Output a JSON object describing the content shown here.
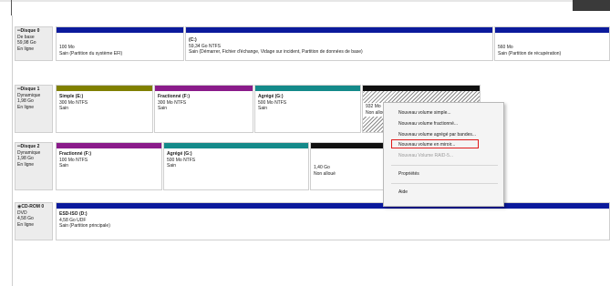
{
  "disks": [
    {
      "name": "Disque 0",
      "type": "De base",
      "size": "59,98 Go",
      "status": "En ligne",
      "partitions": [
        {
          "name": "",
          "size": "100 Mo",
          "fs": "",
          "status": "Sain (Partition du système EFI)"
        },
        {
          "name": "(C:)",
          "size": "59,34 Go NTFS",
          "fs": "",
          "status": "Sain (Démarrer, Fichier d'échange, Vidage sur incident, Partition de données de base)"
        },
        {
          "name": "",
          "size": "560 Mo",
          "fs": "",
          "status": "Sain (Partition de récupération)"
        }
      ]
    },
    {
      "name": "Disque 1",
      "type": "Dynamique",
      "size": "1,98 Go",
      "status": "En ligne",
      "partitions": [
        {
          "name": "Simple (E:)",
          "size": "300 Mo NTFS",
          "status": "Sain"
        },
        {
          "name": "Fractionné (F:)",
          "size": "300 Mo NTFS",
          "status": "Sain"
        },
        {
          "name": "Agrégé (G:)",
          "size": "500 Mo NTFS",
          "status": "Sain"
        },
        {
          "name": "",
          "size": "932 Mo",
          "status": "Non alloué"
        }
      ]
    },
    {
      "name": "Disque 2",
      "type": "Dynamique",
      "size": "1,98 Go",
      "status": "En ligne",
      "partitions": [
        {
          "name": "Fractionné (F:)",
          "size": "100 Mo NTFS",
          "status": "Sain"
        },
        {
          "name": "Agrégé (G:)",
          "size": "500 Mo NTFS",
          "status": "Sain"
        },
        {
          "name": "",
          "size": "1,40 Go",
          "status": "Non alloué"
        }
      ]
    },
    {
      "name": "CD-ROM 0",
      "type": "DVD",
      "size": "4,58 Go",
      "status": "En ligne",
      "partitions": [
        {
          "name": "ESD-ISO (D:)",
          "size": "4,58 Go UDF",
          "status": "Sain (Partition principale)"
        }
      ]
    }
  ],
  "context_menu": {
    "items": [
      {
        "label": "Nouveau volume simple...",
        "enabled": true
      },
      {
        "label": "Nouveau volume fractionné...",
        "enabled": true
      },
      {
        "label": "Nouveau volume agrégé par bandes...",
        "enabled": true
      },
      {
        "label": "Nouveau volume en miroir...",
        "enabled": true,
        "highlighted": true
      },
      {
        "label": "Nouveau Volume RAID-5...",
        "enabled": false
      },
      {
        "label": "Propriétés",
        "enabled": true
      },
      {
        "label": "Aide",
        "enabled": true
      }
    ]
  },
  "colors": {
    "primary_partition": "#0b1a9c",
    "simple_volume": "#808000",
    "spanned_volume": "#8a1b8a",
    "striped_volume": "#148a8a",
    "unallocated": "#101010",
    "highlight_box": "#e01a1a"
  }
}
